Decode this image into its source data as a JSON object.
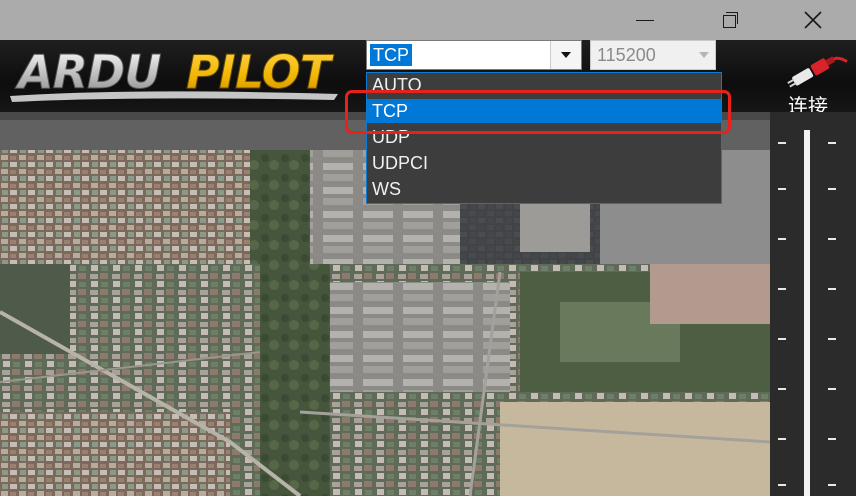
{
  "window": {
    "minimize_icon": "minimize-icon",
    "restore_icon": "restore-icon",
    "close_icon": "close-icon"
  },
  "toolbar": {
    "logo_text": "ARDUPILOT",
    "connection_type": {
      "selected": "TCP",
      "options": [
        "AUTO",
        "TCP",
        "UDP",
        "UDPCI",
        "WS"
      ],
      "highlighted_index": 1
    },
    "baud_rate": "115200",
    "connect_label": "连接",
    "connect_icon": "plug-icon"
  },
  "annotation": {
    "highlight_color": "#e8221b",
    "highlighted_item": "TCP"
  },
  "colors": {
    "accent": "#0078d7",
    "toolbar_bg": "#111111",
    "logo_yellow": "#f0b400"
  }
}
